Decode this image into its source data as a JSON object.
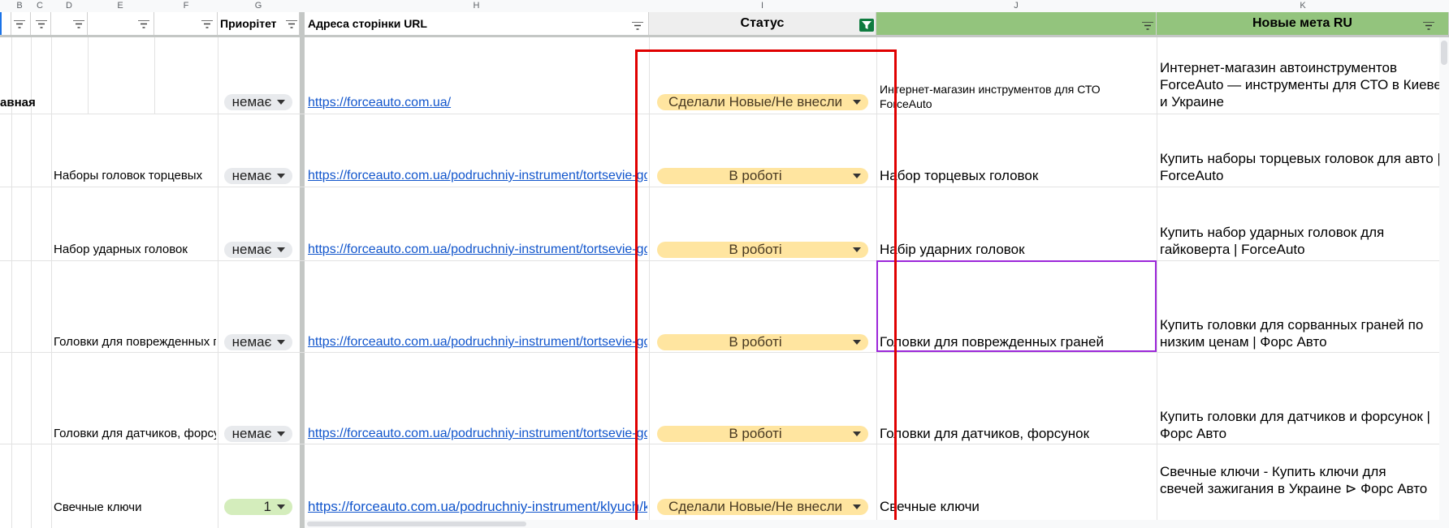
{
  "columns": {
    "letters": [
      "B",
      "C",
      "D",
      "E",
      "F",
      "G",
      "H",
      "I",
      "J",
      "K"
    ]
  },
  "header": {
    "priority": "Приорітет",
    "url": "Адреса сторінки URL",
    "status": "Статус",
    "new_meta_ru": "Новые мета RU"
  },
  "rows": [
    {
      "name": "авная",
      "priority": "немає",
      "url": "https://forceauto.com.ua/",
      "status": "Сделали Новые/Не внесли",
      "meta_old": "Интернет-магазин инструментов для СТО ForceAuto",
      "meta_new": "Интернет-магазин автоинструментов ForceAuto — инструменты для СТО в Киеве и Украине"
    },
    {
      "name": "Наборы головок торцевых",
      "priority": "немає",
      "url": "https://forceauto.com.ua/podruchniy-instrument/tortsevie-go",
      "status": "В роботі",
      "meta_old": "Набор торцевых головок",
      "meta_new": "Купить наборы торцевых головок для авто | ForceAuto"
    },
    {
      "name": "Набор ударных головок",
      "priority": "немає",
      "url": "https://forceauto.com.ua/podruchniy-instrument/tortsevie-go",
      "status": "В роботі",
      "meta_old": "Набір ударних головок",
      "meta_new": "Купить набор ударных головок для гайковерта | ForceAuto"
    },
    {
      "name": "Головки для поврежденных г",
      "priority": "немає",
      "url": "https://forceauto.com.ua/podruchniy-instrument/tortsevie-go",
      "status": "В роботі",
      "meta_old": "Головки для поврежденных граней",
      "meta_new": "Купить головки для сорванных граней по низким ценам | Форс Авто"
    },
    {
      "name": "Головки для датчиков, форсу",
      "priority": "немає",
      "url": "https://forceauto.com.ua/podruchniy-instrument/tortsevie-go",
      "status": "В роботі",
      "meta_old": "Головки для датчиков, форсунок",
      "meta_new": "Купить головки для датчиков и форсунок | Форс Авто"
    },
    {
      "name": "Свечные ключи",
      "priority": "1",
      "url": "https://forceauto.com.ua/podruchniy-instrument/klyuch/kly",
      "status": "Сделали Новые/Не внесли",
      "meta_old": "Свечные ключи",
      "meta_new": "Свечные ключи - Купить ключи для свечей зажигания в Украине ⊳ Форс Авто"
    }
  ],
  "colors": {
    "header_green": "#93c47d",
    "status_chip": "#ffe5a0",
    "highlight_red": "#e00000",
    "selection_purple": "#9c27d9",
    "link": "#1155cc"
  }
}
